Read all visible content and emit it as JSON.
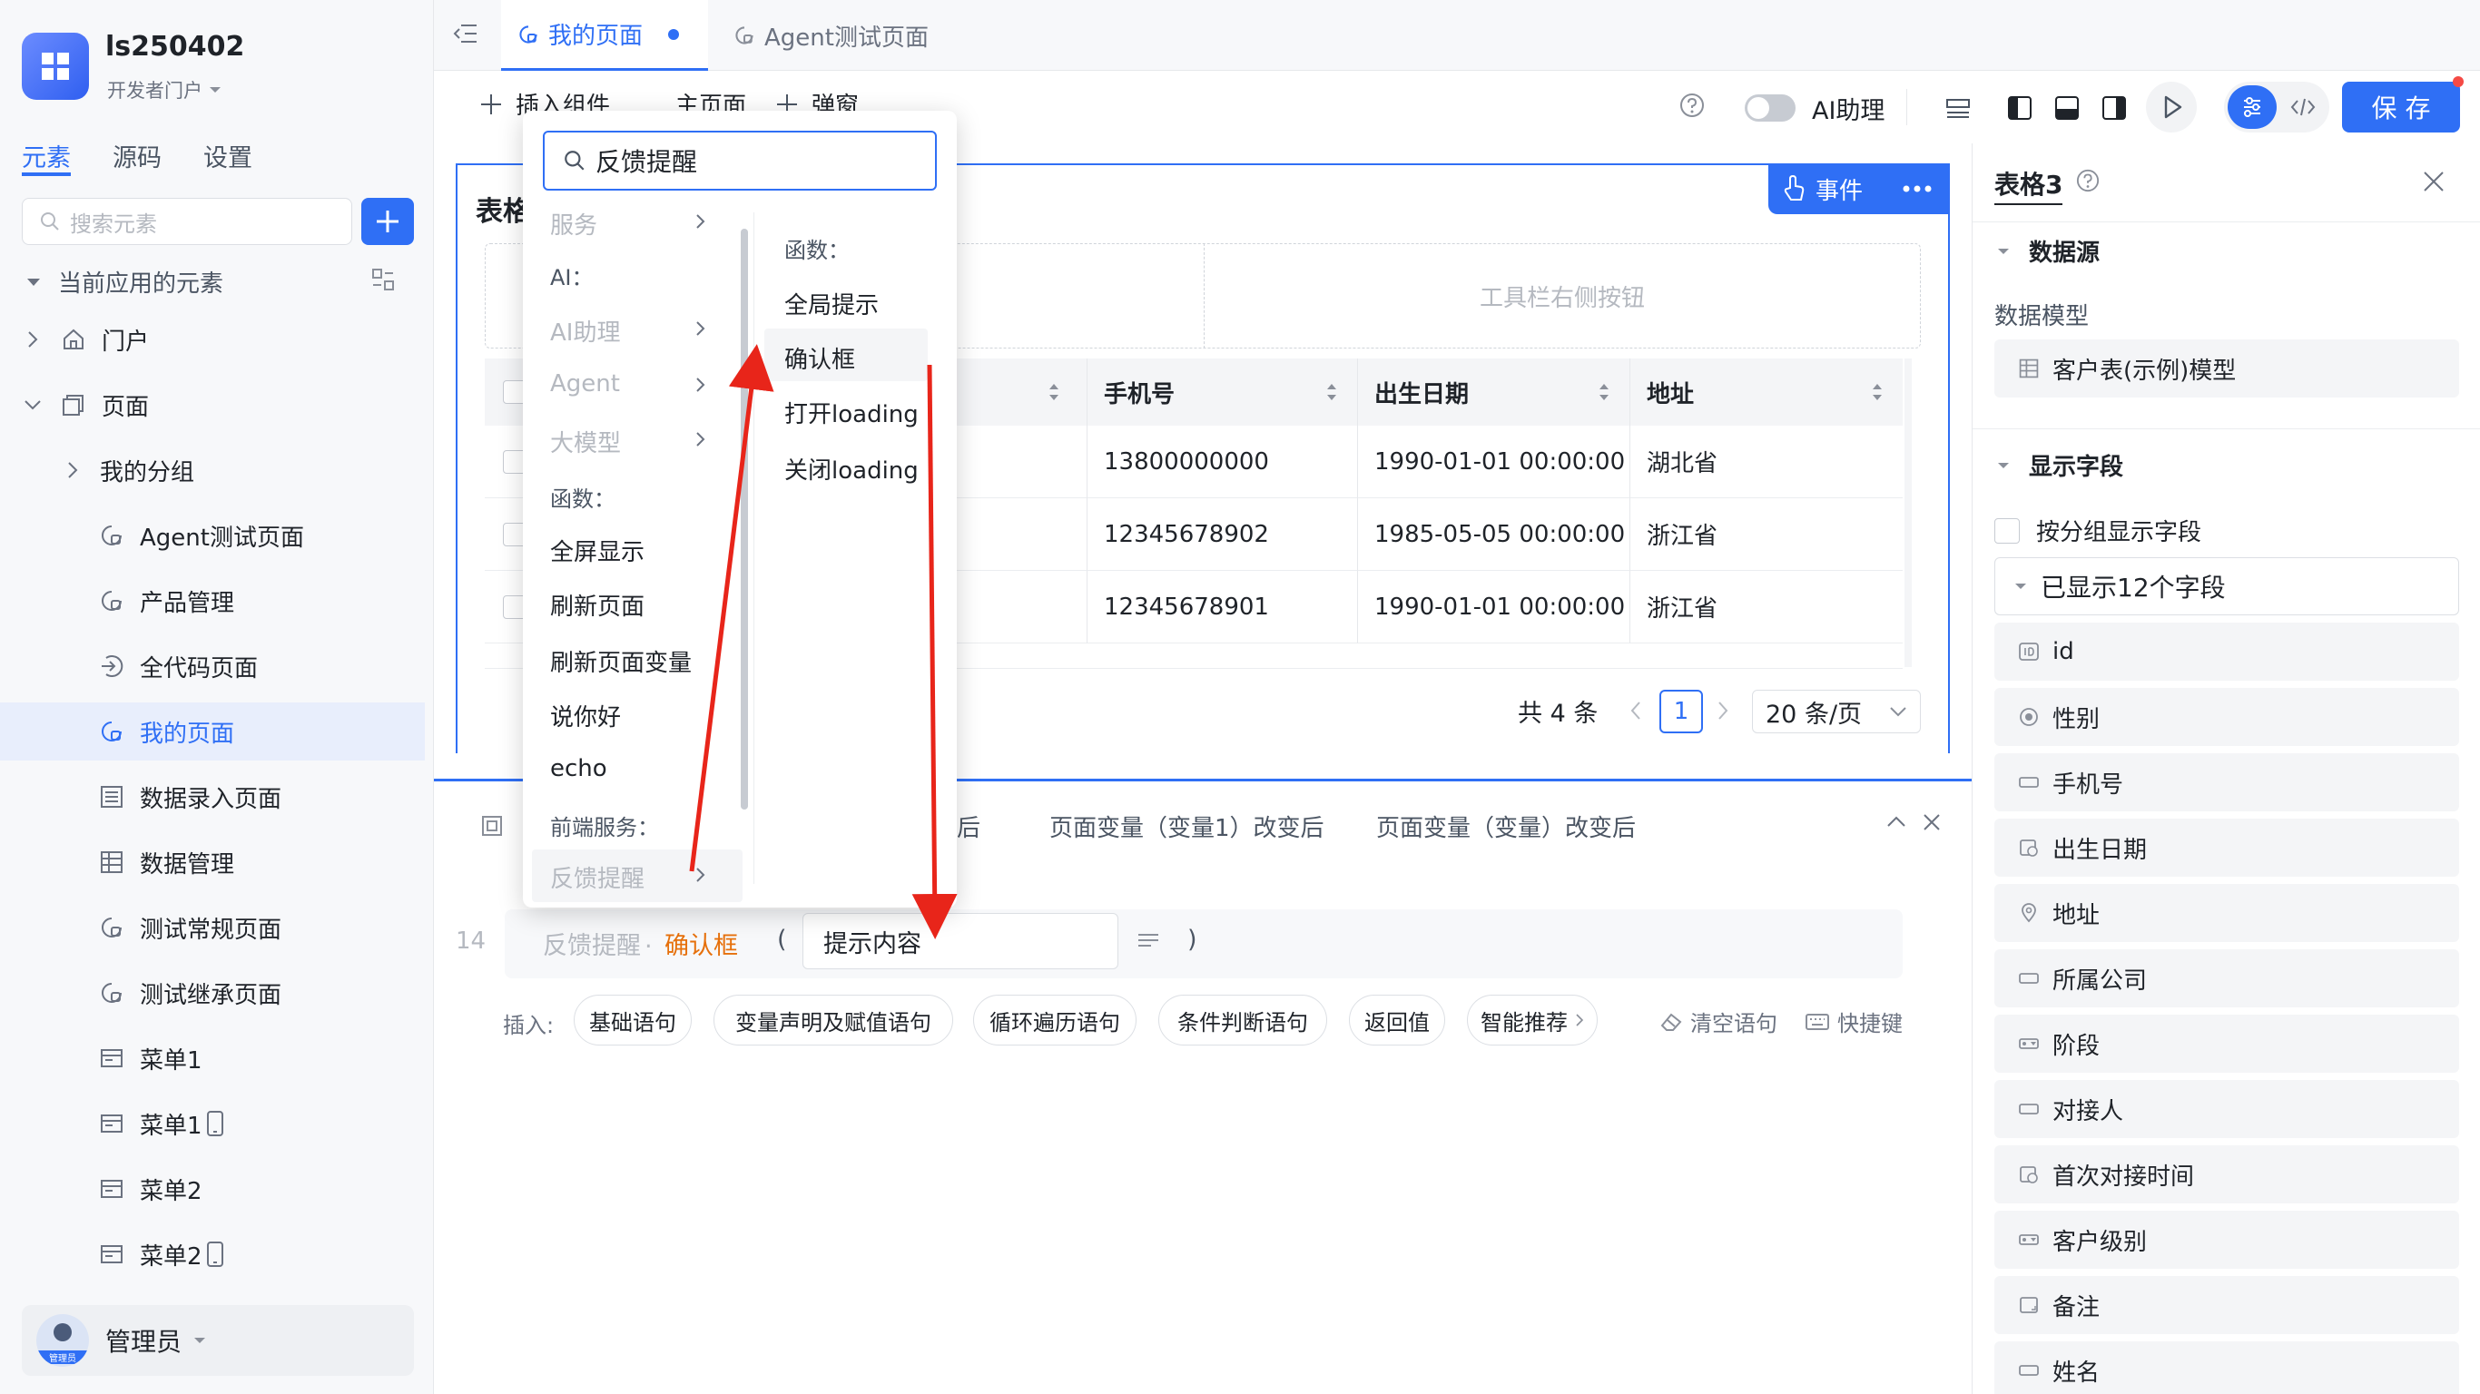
{
  "app": {
    "name": "ls250402",
    "portal": "开发者门户"
  },
  "sidebar": {
    "tabs": [
      "元素",
      "源码",
      "设置"
    ],
    "search_placeholder": "搜索元素",
    "section_title": "当前应用的元素",
    "items": [
      "门户",
      "页面",
      "我的分组",
      "Agent测试页面",
      "产品管理",
      "全代码页面",
      "我的页面",
      "数据录入页面",
      "数据管理",
      "测试常规页面",
      "测试继承页面",
      "菜单1",
      "菜单1",
      "菜单2",
      "菜单2"
    ],
    "user": {
      "name": "管理员",
      "avatar_label": "管理员"
    }
  },
  "tabs": [
    {
      "label": "我的页面",
      "active": true
    },
    {
      "label": "Agent测试页面",
      "active": false
    }
  ],
  "toolbar": {
    "insert_component": "插入组件",
    "main_page": "主页面",
    "popup": "弹窗",
    "ai_assistant": "AI助理",
    "save": "保 存"
  },
  "canvas": {
    "table_title": "表格",
    "event_button": "事件",
    "toolbar_right": "工具栏右侧按钮",
    "columns": [
      "手机号",
      "出生日期",
      "地址"
    ],
    "rows": [
      [
        "13800000000",
        "1990-01-01 00:00:00",
        "湖北省"
      ],
      [
        "12345678902",
        "1985-05-05 00:00:00",
        "浙江省"
      ],
      [
        "12345678901",
        "1990-01-01 00:00:00",
        "浙江省"
      ]
    ],
    "pagination": {
      "total": "共 4 条",
      "page": "1",
      "page_size": "20 条/页"
    }
  },
  "bottom_panel": {
    "tabs": [
      "后",
      "页面变量（变量1）改变后",
      "页面变量（变量）改变后"
    ],
    "line_number": "14",
    "code": {
      "prefix": "反馈提醒",
      "dot": ".",
      "method": "确认框",
      "open_paren": "(",
      "param_value": "提示内容",
      "close_paren": ")"
    },
    "insert_label": "插入:",
    "chips": [
      "基础语句",
      "变量声明及赋值语句",
      "循环遍历语句",
      "条件判断语句",
      "返回值",
      "智能推荐"
    ],
    "clear": "清空语句",
    "shortcut": "快捷键"
  },
  "dropdown": {
    "search_value": "反馈提醒",
    "left_items": [
      {
        "label": "服务",
        "disabled": true,
        "chevron": true
      },
      {
        "label": "AI：",
        "disabled": false,
        "chevron": false
      },
      {
        "label": "AI助理",
        "disabled": true,
        "chevron": true
      },
      {
        "label": "Agent",
        "disabled": true,
        "chevron": true
      },
      {
        "label": "大模型",
        "disabled": true,
        "chevron": true
      },
      {
        "label": "函数：",
        "disabled": false,
        "chevron": false
      },
      {
        "label": "全屏显示",
        "disabled": false,
        "chevron": false
      },
      {
        "label": "刷新页面",
        "disabled": false,
        "chevron": false
      },
      {
        "label": "刷新页面变量",
        "disabled": false,
        "chevron": false
      },
      {
        "label": "说你好",
        "disabled": false,
        "chevron": false
      },
      {
        "label": "echo",
        "disabled": false,
        "chevron": false
      },
      {
        "label": "前端服务：",
        "disabled": false,
        "chevron": false
      },
      {
        "label": "反馈提醒",
        "disabled": true,
        "chevron": true
      }
    ],
    "right_header": "函数：",
    "right_items": [
      "全局提示",
      "确认框",
      "打开loading",
      "关闭loading"
    ]
  },
  "right_panel": {
    "title": "表格3",
    "data_source": "数据源",
    "data_model_label": "数据模型",
    "data_model_value": "客户表(示例)模型",
    "display_fields": "显示字段",
    "group_display": "按分组显示字段",
    "shown_count": "已显示12个字段",
    "fields": [
      "id",
      "性别",
      "手机号",
      "出生日期",
      "地址",
      "所属公司",
      "阶段",
      "对接人",
      "首次对接时间",
      "客户级别",
      "备注",
      "姓名"
    ]
  },
  "colors": {
    "accent": "#2f6ff5",
    "annotation_red": "#e8251a",
    "method_orange": "#e6700b"
  }
}
